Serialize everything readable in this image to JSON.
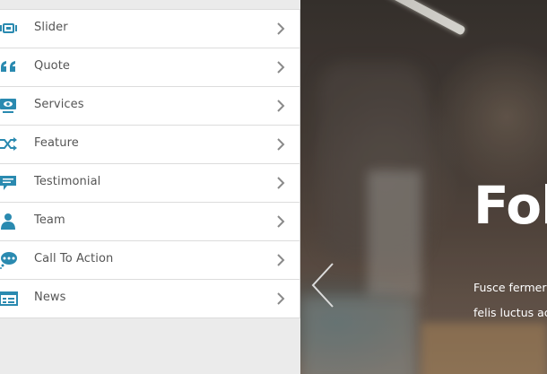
{
  "menu": {
    "items": [
      {
        "label": "Slider",
        "icon": "slider-icon"
      },
      {
        "label": "Quote",
        "icon": "quote-icon"
      },
      {
        "label": "Services",
        "icon": "monitor-icon"
      },
      {
        "label": "Feature",
        "icon": "shuffle-icon"
      },
      {
        "label": "Testimonial",
        "icon": "speech-bubble-icon"
      },
      {
        "label": "Team",
        "icon": "person-icon"
      },
      {
        "label": "Call To Action",
        "icon": "chat-dots-icon"
      },
      {
        "label": "News",
        "icon": "news-grid-icon"
      }
    ],
    "icon_color": "#2a8ab0",
    "chevron_color": "#8a8a8a"
  },
  "hero": {
    "title": "Fol",
    "text_line1": "Fusce fermer",
    "text_line2": "felis luctus ac"
  }
}
